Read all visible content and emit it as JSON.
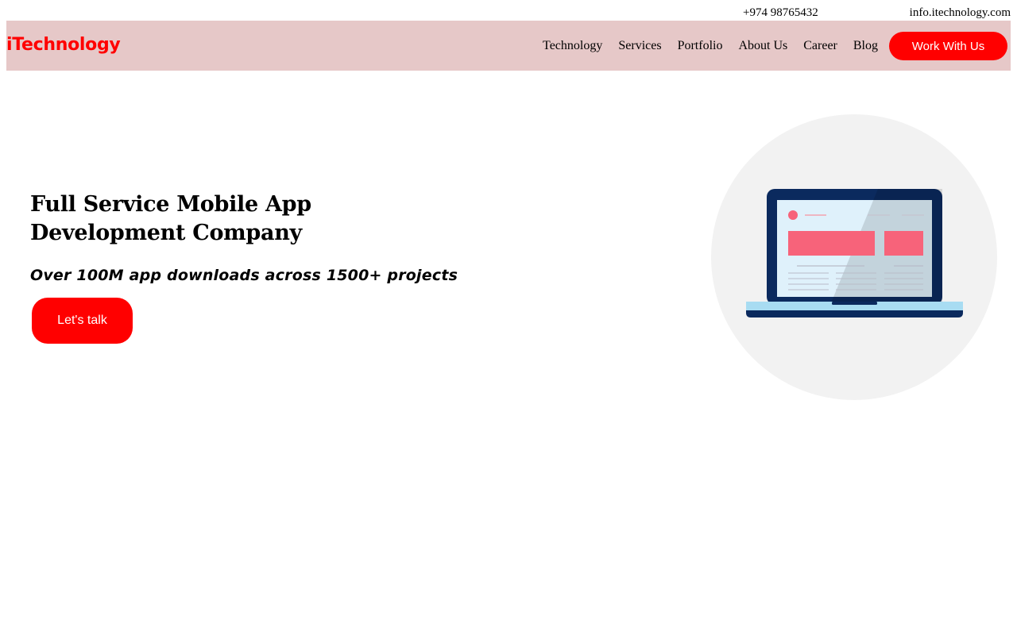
{
  "topbar": {
    "phone": "+974 98765432",
    "email": "info.itechnology.com"
  },
  "header": {
    "logo": "iTechnology",
    "nav": [
      "Technology",
      "Services",
      "Portfolio",
      "About Us",
      "Career",
      "Blog"
    ],
    "cta_label": "Work With Us"
  },
  "hero": {
    "title_line1": "Full Service Mobile App",
    "title_line2": "Development Company",
    "subtitle": "Over 100M app downloads across 1500+ projects",
    "cta_label": "Let's talk"
  },
  "illustration": {
    "name": "laptop-illustration"
  },
  "colors": {
    "accent": "#ff0000",
    "navbar_bg": "#e6c8c8",
    "illustration_circle": "#f2f2f2",
    "laptop_frame": "#0b2a5e",
    "laptop_screen": "#dff1fb",
    "card_pink": "#f7637a"
  }
}
